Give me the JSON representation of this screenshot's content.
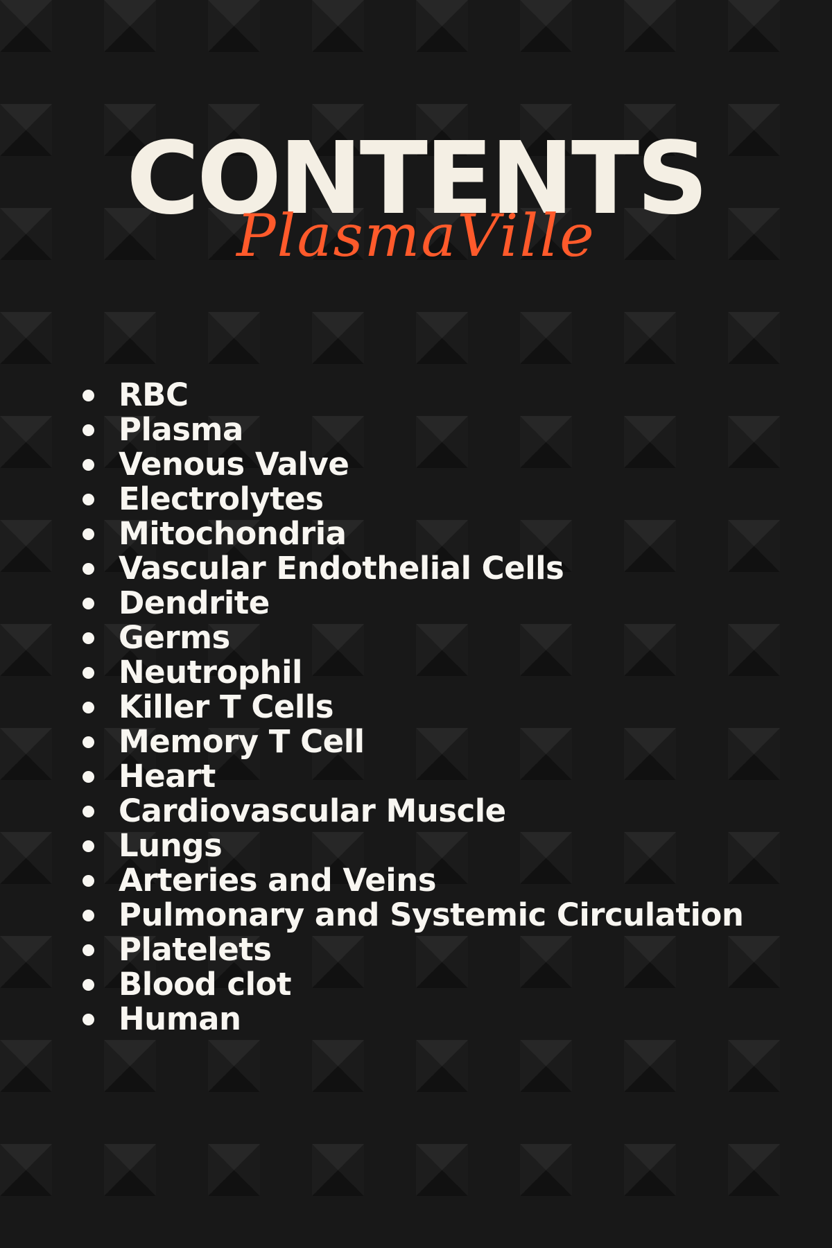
{
  "header": {
    "title": "CONTENTS",
    "subtitle": "PlasmaVille"
  },
  "contents": [
    "RBC",
    "Plasma",
    "Venous Valve",
    "Electrolytes",
    "Mitochondria",
    "Vascular Endothelial Cells",
    "Dendrite",
    "Germs",
    "Neutrophil",
    "Killer T Cells",
    "Memory T Cell",
    "Heart",
    "Cardiovascular Muscle",
    "Lungs",
    "Arteries and Veins",
    "Pulmonary and Systemic Circulation",
    "Platelets",
    "Blood clot",
    "Human"
  ],
  "colors": {
    "background": "#181818",
    "title": "#f4efe4",
    "accent": "#ff5a2b",
    "text": "#f8f6f1"
  }
}
